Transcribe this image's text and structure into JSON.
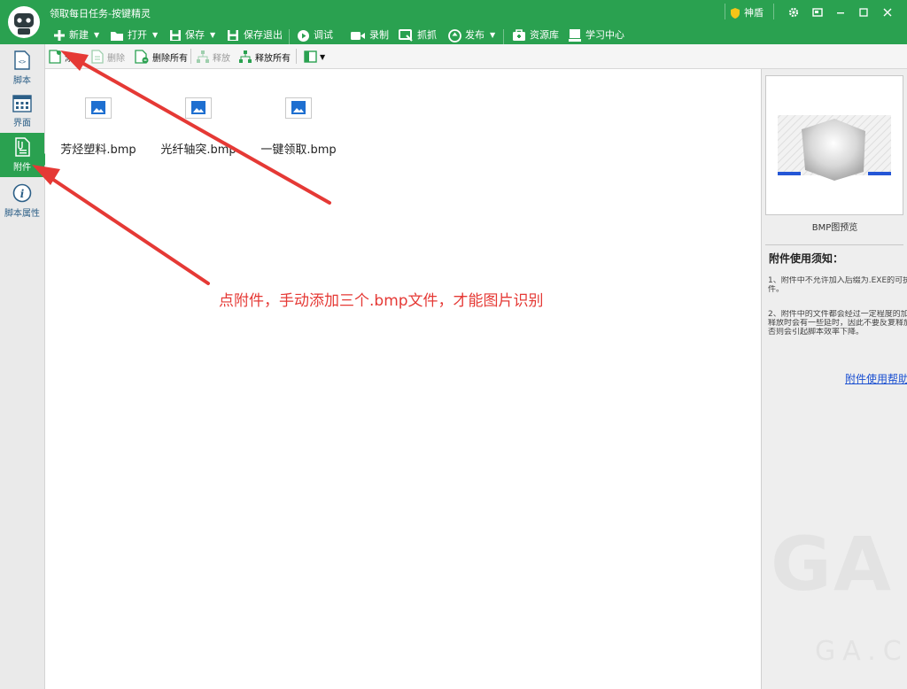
{
  "window": {
    "title": "领取每日任务-按键精灵",
    "shield_label": "神盾"
  },
  "toolbar": {
    "new_label": "新建",
    "open_label": "打开",
    "save_label": "保存",
    "save_exit_label": "保存退出",
    "debug_label": "调试",
    "record_label": "录制",
    "grab_label": "抓抓",
    "publish_label": "发布",
    "resources_label": "资源库",
    "learn_label": "学习中心"
  },
  "sidebar": {
    "items": [
      {
        "label": "脚本",
        "icon": "script-icon"
      },
      {
        "label": "界面",
        "icon": "layout-grid-icon"
      },
      {
        "label": "附件",
        "icon": "attachment-icon",
        "active": true
      },
      {
        "label": "脚本属性",
        "icon": "info-icon"
      }
    ]
  },
  "subtoolbar": {
    "add_label": "添加",
    "delete_label": "删除",
    "delete_all_label": "删除所有",
    "release_label": "释放",
    "release_all_label": "释放所有"
  },
  "attachments": [
    {
      "name": "芳烃塑料.bmp"
    },
    {
      "name": "光纤轴突.bmp"
    },
    {
      "name": "一键领取.bmp"
    }
  ],
  "annotation": {
    "text": "点附件，手动添加三个.bmp文件，才能图片识别",
    "color": "#e53935"
  },
  "right_panel": {
    "preview_caption": "BMP图预览",
    "notice_title": "附件使用须知：",
    "notice_1_line1": "1、附件中不允许加入后缀为.EXE的可执",
    "notice_1_line2": "件。",
    "notice_2_line1": "2、附件中的文件都会经过一定程度的加",
    "notice_2_line2": "释放时会有一些延时，因此不要反复释放",
    "notice_2_line3": "否则会引起脚本效率下降。",
    "help_link": "附件使用帮助"
  },
  "colors": {
    "brand_green": "#2aa150",
    "link_blue": "#1a4fd1"
  }
}
